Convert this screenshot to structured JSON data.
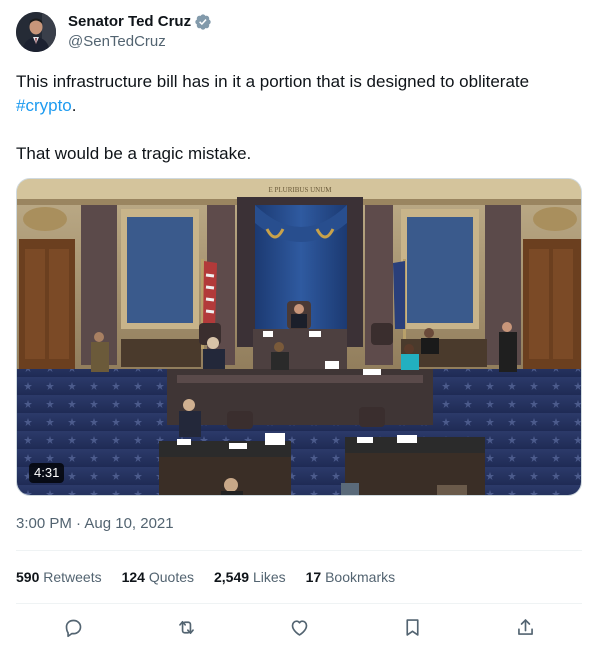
{
  "author": {
    "display_name": "Senator Ted Cruz",
    "handle": "@SenTedCruz"
  },
  "tweet": {
    "line1": "This infrastructure bill has in it a portion that is designed to obliterate",
    "hashtag": "#crypto",
    "line2_suffix": ".",
    "line3": "That would be a tragic mistake."
  },
  "media": {
    "duration": "4:31",
    "top_inscription": "E PLURIBUS UNUM"
  },
  "timestamp": "3:00 PM · Aug 10, 2021",
  "stats": {
    "retweets_num": "590",
    "retweets_label": "Retweets",
    "quotes_num": "124",
    "quotes_label": "Quotes",
    "likes_num": "2,549",
    "likes_label": "Likes",
    "bookmarks_num": "17",
    "bookmarks_label": "Bookmarks"
  },
  "actions": [
    "reply-icon",
    "retweet-icon",
    "like-icon",
    "bookmark-icon",
    "share-icon"
  ],
  "colors": {
    "link": "#1d9bf0",
    "verified": "#829aab",
    "secondary_text": "#536471",
    "primary_text": "#0f1419"
  }
}
